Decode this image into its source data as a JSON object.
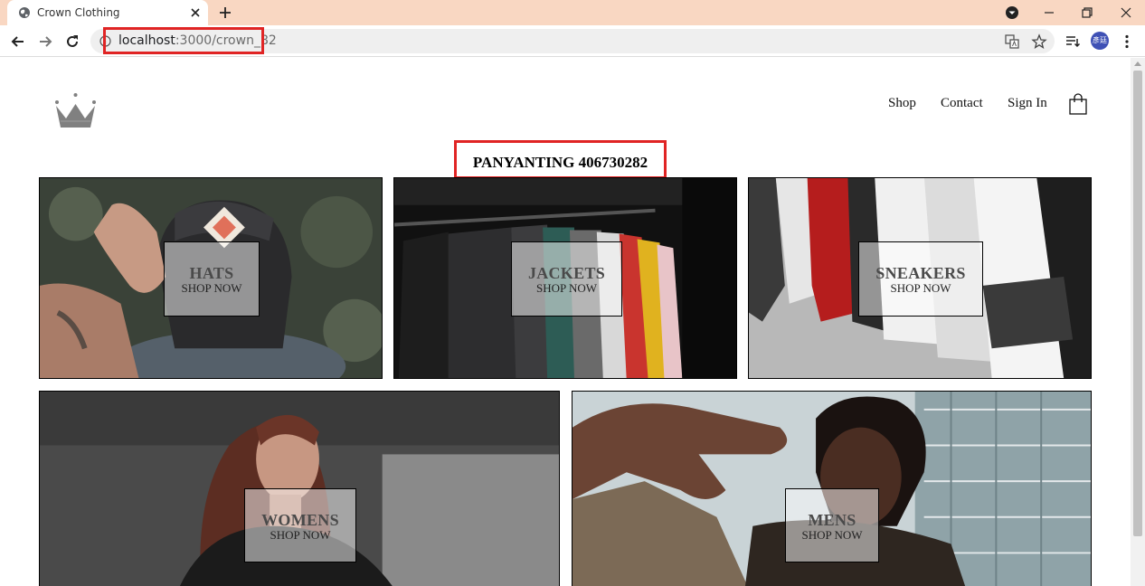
{
  "browser": {
    "tab_title": "Crown Clothing",
    "url_host": "localhost",
    "url_path": ":3000/crown_82",
    "profile_initials": "彥廷"
  },
  "header": {
    "nav": {
      "shop": "Shop",
      "contact": "Contact",
      "sign_in": "Sign In"
    },
    "user_title": "PANYANTING 406730282"
  },
  "directory": {
    "sections": [
      {
        "title": "HATS",
        "subtitle": "SHOP NOW"
      },
      {
        "title": "JACKETS",
        "subtitle": "SHOP NOW"
      },
      {
        "title": "SNEAKERS",
        "subtitle": "SHOP NOW"
      },
      {
        "title": "WOMENS",
        "subtitle": "SHOP NOW"
      },
      {
        "title": "MENS",
        "subtitle": "SHOP NOW"
      }
    ]
  },
  "colors": {
    "tabstrip": "#f9d7c2",
    "highlight_box": "#e02424",
    "crown_logo": "#808080"
  },
  "icons": [
    "globe-icon",
    "close-icon",
    "plus-icon",
    "back-icon",
    "forward-icon",
    "reload-icon",
    "info-icon",
    "translate-icon",
    "star-icon",
    "reading-list-icon",
    "menu-icon",
    "crown-logo-icon",
    "shopping-bag-icon"
  ]
}
